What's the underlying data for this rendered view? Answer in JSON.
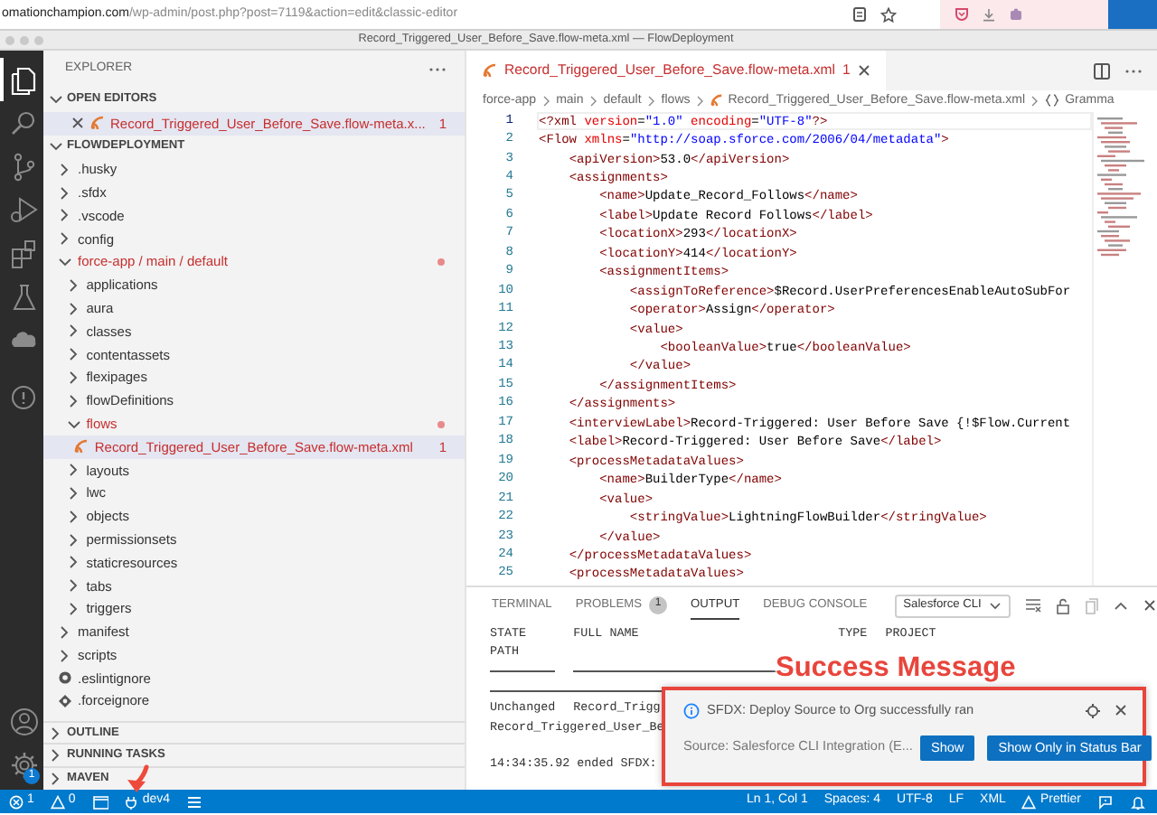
{
  "browser": {
    "host": "omationchampion.com",
    "path": "/wp-admin/post.php?post=7119&action=edit&classic-editor"
  },
  "window": {
    "title": "Record_Triggered_User_Before_Save.flow-meta.xml — FlowDeployment"
  },
  "activity_bar": [
    {
      "kind": "explorer",
      "selected": true
    },
    {
      "kind": "search",
      "selected": false
    },
    {
      "kind": "source-control",
      "selected": false
    },
    {
      "kind": "run-debug",
      "selected": false
    },
    {
      "kind": "extensions",
      "selected": false
    },
    {
      "kind": "testing",
      "selected": false
    },
    {
      "kind": "salesforce",
      "selected": false
    },
    {
      "kind": "info",
      "selected": false
    }
  ],
  "activity_bottom": [
    {
      "kind": "account"
    },
    {
      "kind": "manage",
      "badge": "1"
    }
  ],
  "sidebar": {
    "title": "EXPLORER",
    "open_editors": {
      "label": "OPEN EDITORS",
      "expanded": true,
      "items": [
        {
          "name": "Record_Triggered_User_Before_Save.flow-meta.x...",
          "problems": "1",
          "error": true,
          "selected": true
        }
      ]
    },
    "project": {
      "label": "FLOWDEPLOYMENT",
      "expanded": true,
      "children": [
        {
          "name": ".husky",
          "kind": "folder",
          "expanded": false,
          "error": false,
          "selected": false
        },
        {
          "name": ".sfdx",
          "kind": "folder",
          "expanded": false,
          "error": false,
          "selected": false
        },
        {
          "name": ".vscode",
          "kind": "folder",
          "expanded": false,
          "error": false,
          "selected": false
        },
        {
          "name": "config",
          "kind": "folder",
          "expanded": false,
          "error": false,
          "selected": false
        },
        {
          "name": "force-app / main / default",
          "kind": "folder",
          "expanded": true,
          "error": true,
          "selected": false,
          "children": [
            {
              "name": "applications",
              "kind": "folder",
              "expanded": false,
              "error": false,
              "selected": false
            },
            {
              "name": "aura",
              "kind": "folder",
              "expanded": false,
              "error": false,
              "selected": false
            },
            {
              "name": "classes",
              "kind": "folder",
              "expanded": false,
              "error": false,
              "selected": false
            },
            {
              "name": "contentassets",
              "kind": "folder",
              "expanded": false,
              "error": false,
              "selected": false
            },
            {
              "name": "flexipages",
              "kind": "folder",
              "expanded": false,
              "error": false,
              "selected": false
            },
            {
              "name": "flowDefinitions",
              "kind": "folder",
              "expanded": false,
              "error": false,
              "selected": false
            },
            {
              "name": "flows",
              "kind": "folder",
              "expanded": true,
              "error": true,
              "selected": false,
              "children": [
                {
                  "name": "Record_Triggered_User_Before_Save.flow-meta.xml",
                  "kind": "xml-file",
                  "problems": "1",
                  "error": true,
                  "selected": true
                }
              ]
            },
            {
              "name": "layouts",
              "kind": "folder",
              "expanded": false,
              "error": false,
              "selected": false
            },
            {
              "name": "lwc",
              "kind": "folder",
              "expanded": false,
              "error": false,
              "selected": false
            },
            {
              "name": "objects",
              "kind": "folder",
              "expanded": false,
              "error": false,
              "selected": false
            },
            {
              "name": "permissionsets",
              "kind": "folder",
              "expanded": false,
              "error": false,
              "selected": false
            },
            {
              "name": "staticresources",
              "kind": "folder",
              "expanded": false,
              "error": false,
              "selected": false
            },
            {
              "name": "tabs",
              "kind": "folder",
              "expanded": false,
              "error": false,
              "selected": false
            },
            {
              "name": "triggers",
              "kind": "folder",
              "expanded": false,
              "error": false,
              "selected": false
            }
          ]
        },
        {
          "name": "manifest",
          "kind": "folder",
          "expanded": false,
          "error": false,
          "selected": false
        },
        {
          "name": "scripts",
          "kind": "folder",
          "expanded": false,
          "error": false,
          "selected": false
        },
        {
          "name": ".eslintignore",
          "kind": "eslint-file",
          "error": false,
          "selected": false
        },
        {
          "name": ".forceignore",
          "kind": "ignore-file",
          "error": false,
          "selected": false
        }
      ]
    },
    "sections": [
      {
        "label": "OUTLINE",
        "expanded": false
      },
      {
        "label": "RUNNING TASKS",
        "expanded": false
      },
      {
        "label": "MAVEN",
        "expanded": false
      }
    ]
  },
  "editor": {
    "tab": {
      "label": "Record_Triggered_User_Before_Save.flow-meta.xml",
      "problems": "1",
      "error": true,
      "selected": true
    },
    "breadcrumb": [
      {
        "kind": "folder",
        "text": "force-app"
      },
      {
        "kind": "folder",
        "text": "main"
      },
      {
        "kind": "folder",
        "text": "default"
      },
      {
        "kind": "folder",
        "text": "flows"
      },
      {
        "kind": "xml-file",
        "text": "Record_Triggered_User_Before_Save.flow-meta.xml"
      },
      {
        "kind": "symbol",
        "text": "Gramma"
      }
    ],
    "lines": [
      {
        "number": "1",
        "code": "<?xml version=\"1.0\" encoding=\"UTF-8\"?>",
        "selected": true
      },
      {
        "number": "2",
        "code": "<Flow xmlns=\"http://soap.sforce.com/2006/04/metadata\">",
        "selected": false
      },
      {
        "number": "3",
        "code": "    <apiVersion>53.0</apiVersion>",
        "selected": false
      },
      {
        "number": "4",
        "code": "    <assignments>",
        "selected": false
      },
      {
        "number": "5",
        "code": "        <name>Update_Record_Follows</name>",
        "selected": false
      },
      {
        "number": "6",
        "code": "        <label>Update Record Follows</label>",
        "selected": false
      },
      {
        "number": "7",
        "code": "        <locationX>293</locationX>",
        "selected": false
      },
      {
        "number": "8",
        "code": "        <locationY>414</locationY>",
        "selected": false
      },
      {
        "number": "9",
        "code": "        <assignmentItems>",
        "selected": false
      },
      {
        "number": "10",
        "code": "            <assignToReference>$Record.UserPreferencesEnableAutoSubFor",
        "selected": false
      },
      {
        "number": "11",
        "code": "            <operator>Assign</operator>",
        "selected": false
      },
      {
        "number": "12",
        "code": "            <value>",
        "selected": false
      },
      {
        "number": "13",
        "code": "                <booleanValue>true</booleanValue>",
        "selected": false
      },
      {
        "number": "14",
        "code": "            </value>",
        "selected": false
      },
      {
        "number": "15",
        "code": "        </assignmentItems>",
        "selected": false
      },
      {
        "number": "16",
        "code": "    </assignments>",
        "selected": false
      },
      {
        "number": "17",
        "code": "    <interviewLabel>Record-Triggered: User Before Save {!$Flow.Current",
        "selected": false
      },
      {
        "number": "18",
        "code": "    <label>Record-Triggered: User Before Save</label>",
        "selected": false
      },
      {
        "number": "19",
        "code": "    <processMetadataValues>",
        "selected": false
      },
      {
        "number": "20",
        "code": "        <name>BuilderType</name>",
        "selected": false
      },
      {
        "number": "21",
        "code": "        <value>",
        "selected": false
      },
      {
        "number": "22",
        "code": "            <stringValue>LightningFlowBuilder</stringValue>",
        "selected": false
      },
      {
        "number": "23",
        "code": "        </value>",
        "selected": false
      },
      {
        "number": "24",
        "code": "    </processMetadataValues>",
        "selected": false
      },
      {
        "number": "25",
        "code": "    <processMetadataValues>",
        "selected": false
      }
    ]
  },
  "panel": {
    "tabs": [
      {
        "label": "TERMINAL",
        "selected": false
      },
      {
        "label": "PROBLEMS",
        "badge": "1",
        "selected": false
      },
      {
        "label": "OUTPUT",
        "selected": true
      },
      {
        "label": "DEBUG CONSOLE",
        "selected": false
      }
    ],
    "channel": "Salesforce CLI",
    "output": [
      {
        "kind": "row",
        "cells": [
          "STATE",
          "FULL NAME",
          "TYPE",
          "PROJECT"
        ]
      },
      {
        "kind": "row",
        "cells": [
          "PATH"
        ]
      },
      {
        "kind": "column-rule"
      },
      {
        "kind": "full-rule"
      },
      {
        "kind": "row",
        "cells": [
          "Unchanged",
          "Record_Trigg"
        ]
      },
      {
        "kind": "row",
        "cells": [
          "Record_Triggered_User_Be"
        ]
      },
      {
        "kind": "blank"
      },
      {
        "kind": "row",
        "cells": [
          "14:34:35.92 ended SFDX:"
        ]
      }
    ]
  },
  "notification": {
    "message": "SFDX: Deploy Source to Org successfully ran",
    "source": "Source: Salesforce CLI Integration (E...",
    "buttons": [
      "Show",
      "Show Only in Status Bar"
    ]
  },
  "annotation": {
    "label": "Success Message"
  },
  "status_bar": {
    "left": [
      {
        "kind": "errors",
        "text": "1"
      },
      {
        "kind": "warnings",
        "text": "0"
      },
      {
        "kind": "panel"
      },
      {
        "kind": "org",
        "text": "dev4"
      },
      {
        "kind": "tasks"
      }
    ],
    "right": [
      {
        "kind": "text",
        "text": "Ln 1, Col 1"
      },
      {
        "kind": "text",
        "text": "Spaces: 4"
      },
      {
        "kind": "text",
        "text": "UTF-8"
      },
      {
        "kind": "text",
        "text": "LF"
      },
      {
        "kind": "text",
        "text": "XML"
      },
      {
        "kind": "prettier",
        "text": "Prettier"
      },
      {
        "kind": "feedback"
      },
      {
        "kind": "bell"
      }
    ]
  }
}
